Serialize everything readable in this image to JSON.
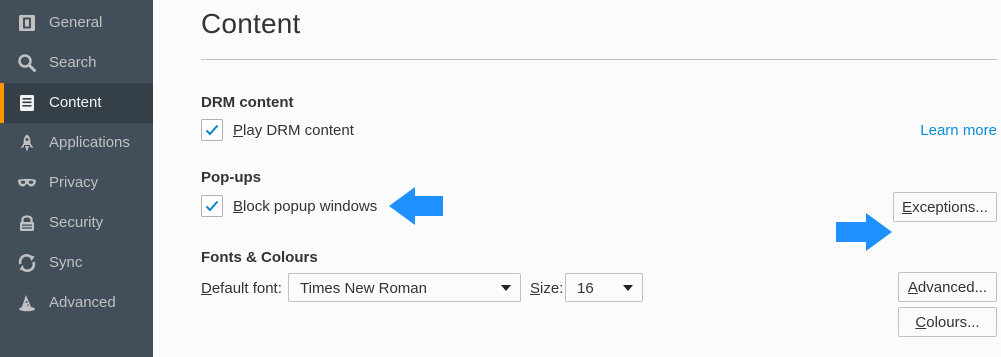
{
  "sidebar": {
    "items": [
      {
        "label": "General",
        "icon": "general-icon"
      },
      {
        "label": "Search",
        "icon": "search-icon"
      },
      {
        "label": "Content",
        "icon": "content-icon",
        "selected": true
      },
      {
        "label": "Applications",
        "icon": "applications-icon"
      },
      {
        "label": "Privacy",
        "icon": "privacy-mask-icon"
      },
      {
        "label": "Security",
        "icon": "security-lock-icon"
      },
      {
        "label": "Sync",
        "icon": "sync-icon"
      },
      {
        "label": "Advanced",
        "icon": "advanced-wizard-hat-icon"
      }
    ]
  },
  "main": {
    "title": "Content",
    "drm": {
      "heading": "DRM content",
      "checkbox_label_accel": "P",
      "checkbox_label_rest": "lay DRM content",
      "checked": true,
      "learn_more": "Learn more"
    },
    "popups": {
      "heading": "Pop-ups",
      "checkbox_label_accel": "B",
      "checkbox_label_rest": "lock popup windows",
      "checked": true,
      "exceptions_accel": "E",
      "exceptions_rest": "xceptions..."
    },
    "fonts": {
      "heading": "Fonts & Colours",
      "default_font_accel": "D",
      "default_font_rest": "efault font:",
      "default_font_value": "Times New Roman",
      "size_accel": "S",
      "size_rest": "ize:",
      "size_value": "16",
      "advanced_accel": "A",
      "advanced_rest": "dvanced...",
      "colours_accel": "C",
      "colours_rest": "olours..."
    }
  },
  "colors": {
    "sidebar_bg": "#424f5a",
    "sidebar_selected": "#343f48",
    "accent_orange": "#ff9500",
    "link_blue": "#0a8dd5",
    "annotation_arrow": "#1e90ff"
  }
}
